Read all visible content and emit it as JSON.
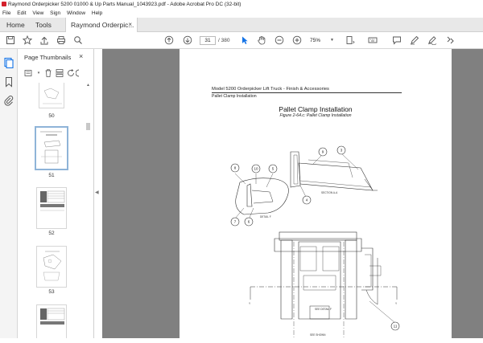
{
  "window": {
    "title": "Raymond Orderpicker 5200 01000 & Up Parts Manual_1043923.pdf - Adobe Acrobat Pro DC (32-bit)"
  },
  "menu": {
    "file": "File",
    "edit": "Edit",
    "view": "View",
    "sign": "Sign",
    "window": "Window",
    "help": "Help"
  },
  "tabs": {
    "home": "Home",
    "tools": "Tools",
    "document": "Raymond Orderpic...",
    "close": "×"
  },
  "toolbar": {
    "current_page": "31",
    "total_pages": "/ 380",
    "zoom": "75%",
    "icons": [
      "save-icon",
      "bookmark-star-icon",
      "upload-icon",
      "print-icon",
      "search-icon",
      "page-up-icon",
      "page-down-icon",
      "select-arrow-icon",
      "hand-tool-icon",
      "zoom-out-icon",
      "zoom-in-icon",
      "fit-page-icon",
      "keyboard-icon",
      "comment-icon",
      "highlight-pen-icon",
      "sign-icon",
      "more-tools-icon"
    ]
  },
  "thumbnails_panel": {
    "title": "Page Thumbnails",
    "close": "×",
    "pages": [
      {
        "number": "50",
        "selected": false
      },
      {
        "number": "51",
        "selected": true
      },
      {
        "number": "52",
        "selected": false
      },
      {
        "number": "53",
        "selected": false
      },
      {
        "number": "",
        "selected": false
      }
    ]
  },
  "document": {
    "header_line1": "Model 5200 Orderpicker Lift Truck - Finish & Accessories",
    "header_line2": "Pallet Clamp Installation",
    "title": "Pallet Clamp Installation",
    "figure_caption": "Figure 2-64.c: Pallet Clamp Installation",
    "callouts": [
      "8",
      "10",
      "5",
      "9",
      "3",
      "4",
      "7",
      "6",
      "11"
    ],
    "labels": {
      "detail": "DETAIL F",
      "section_ref": "SECTION A-A",
      "see_detail": "SEE DETAIL F",
      "see_shown": "SEE SHOWN",
      "axis_y_left": "Y",
      "axis_y_right": "Y"
    }
  },
  "colors": {
    "viewer_bg": "#808080",
    "selection_border": "#8fb4d8",
    "acrobat_red": "#d4202c",
    "select_tool_blue": "#1473e6"
  }
}
